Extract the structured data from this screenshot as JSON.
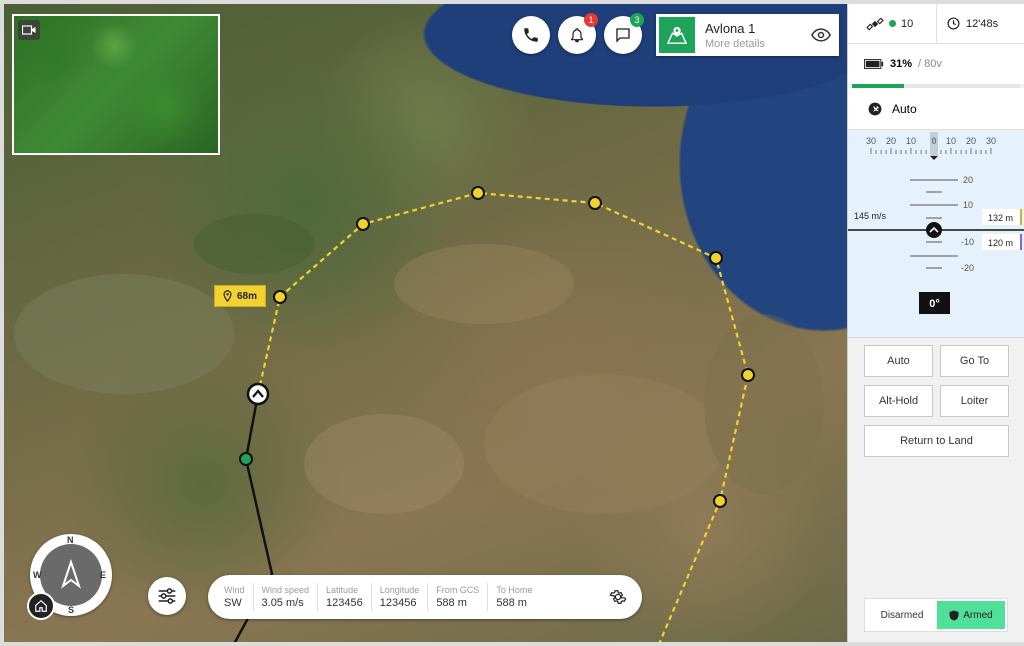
{
  "mission": {
    "title": "Avlona 1",
    "subtitle": "More details"
  },
  "notifications": {
    "alerts_count": "1",
    "messages_count": "3"
  },
  "waypoint_label": "68m",
  "info_bar": [
    {
      "label": "Wind",
      "value": "SW"
    },
    {
      "label": "Wind speed",
      "value": "3.05 m/s"
    },
    {
      "label": "Latitude",
      "value": "123456"
    },
    {
      "label": "Longitude",
      "value": "123456"
    },
    {
      "label": "From GCS",
      "value": "588 m"
    },
    {
      "label": "To Home",
      "value": "588 m"
    }
  ],
  "compass": {
    "n": "N",
    "s": "S",
    "e": "E",
    "w": "W"
  },
  "status": {
    "satellites": "10",
    "flight_time": "12'48s",
    "battery_percent": "31%",
    "battery_voltage": "/ 80v",
    "battery_level": 0.31,
    "mode": "Auto"
  },
  "instrument": {
    "heading_ticks": [
      "30",
      "20",
      "10",
      "0",
      "10",
      "20",
      "30"
    ],
    "pitch_ticks": [
      "20",
      "10",
      "-10",
      "-20"
    ],
    "speed": "145 m/s",
    "altitude_target": "132 m",
    "altitude_current": "120 m",
    "heading_value": "0°"
  },
  "controls": {
    "auto": "Auto",
    "goto": "Go To",
    "althold": "Alt-Hold",
    "loiter": "Loiter",
    "rtl": "Return to Land"
  },
  "arming": {
    "disarmed": "Disarmed",
    "armed": "Armed"
  },
  "colors": {
    "accent_green": "#1da35a",
    "armed_green": "#4fe09a",
    "waypoint_yellow": "#f2d22e",
    "badge_red": "#e53935"
  }
}
